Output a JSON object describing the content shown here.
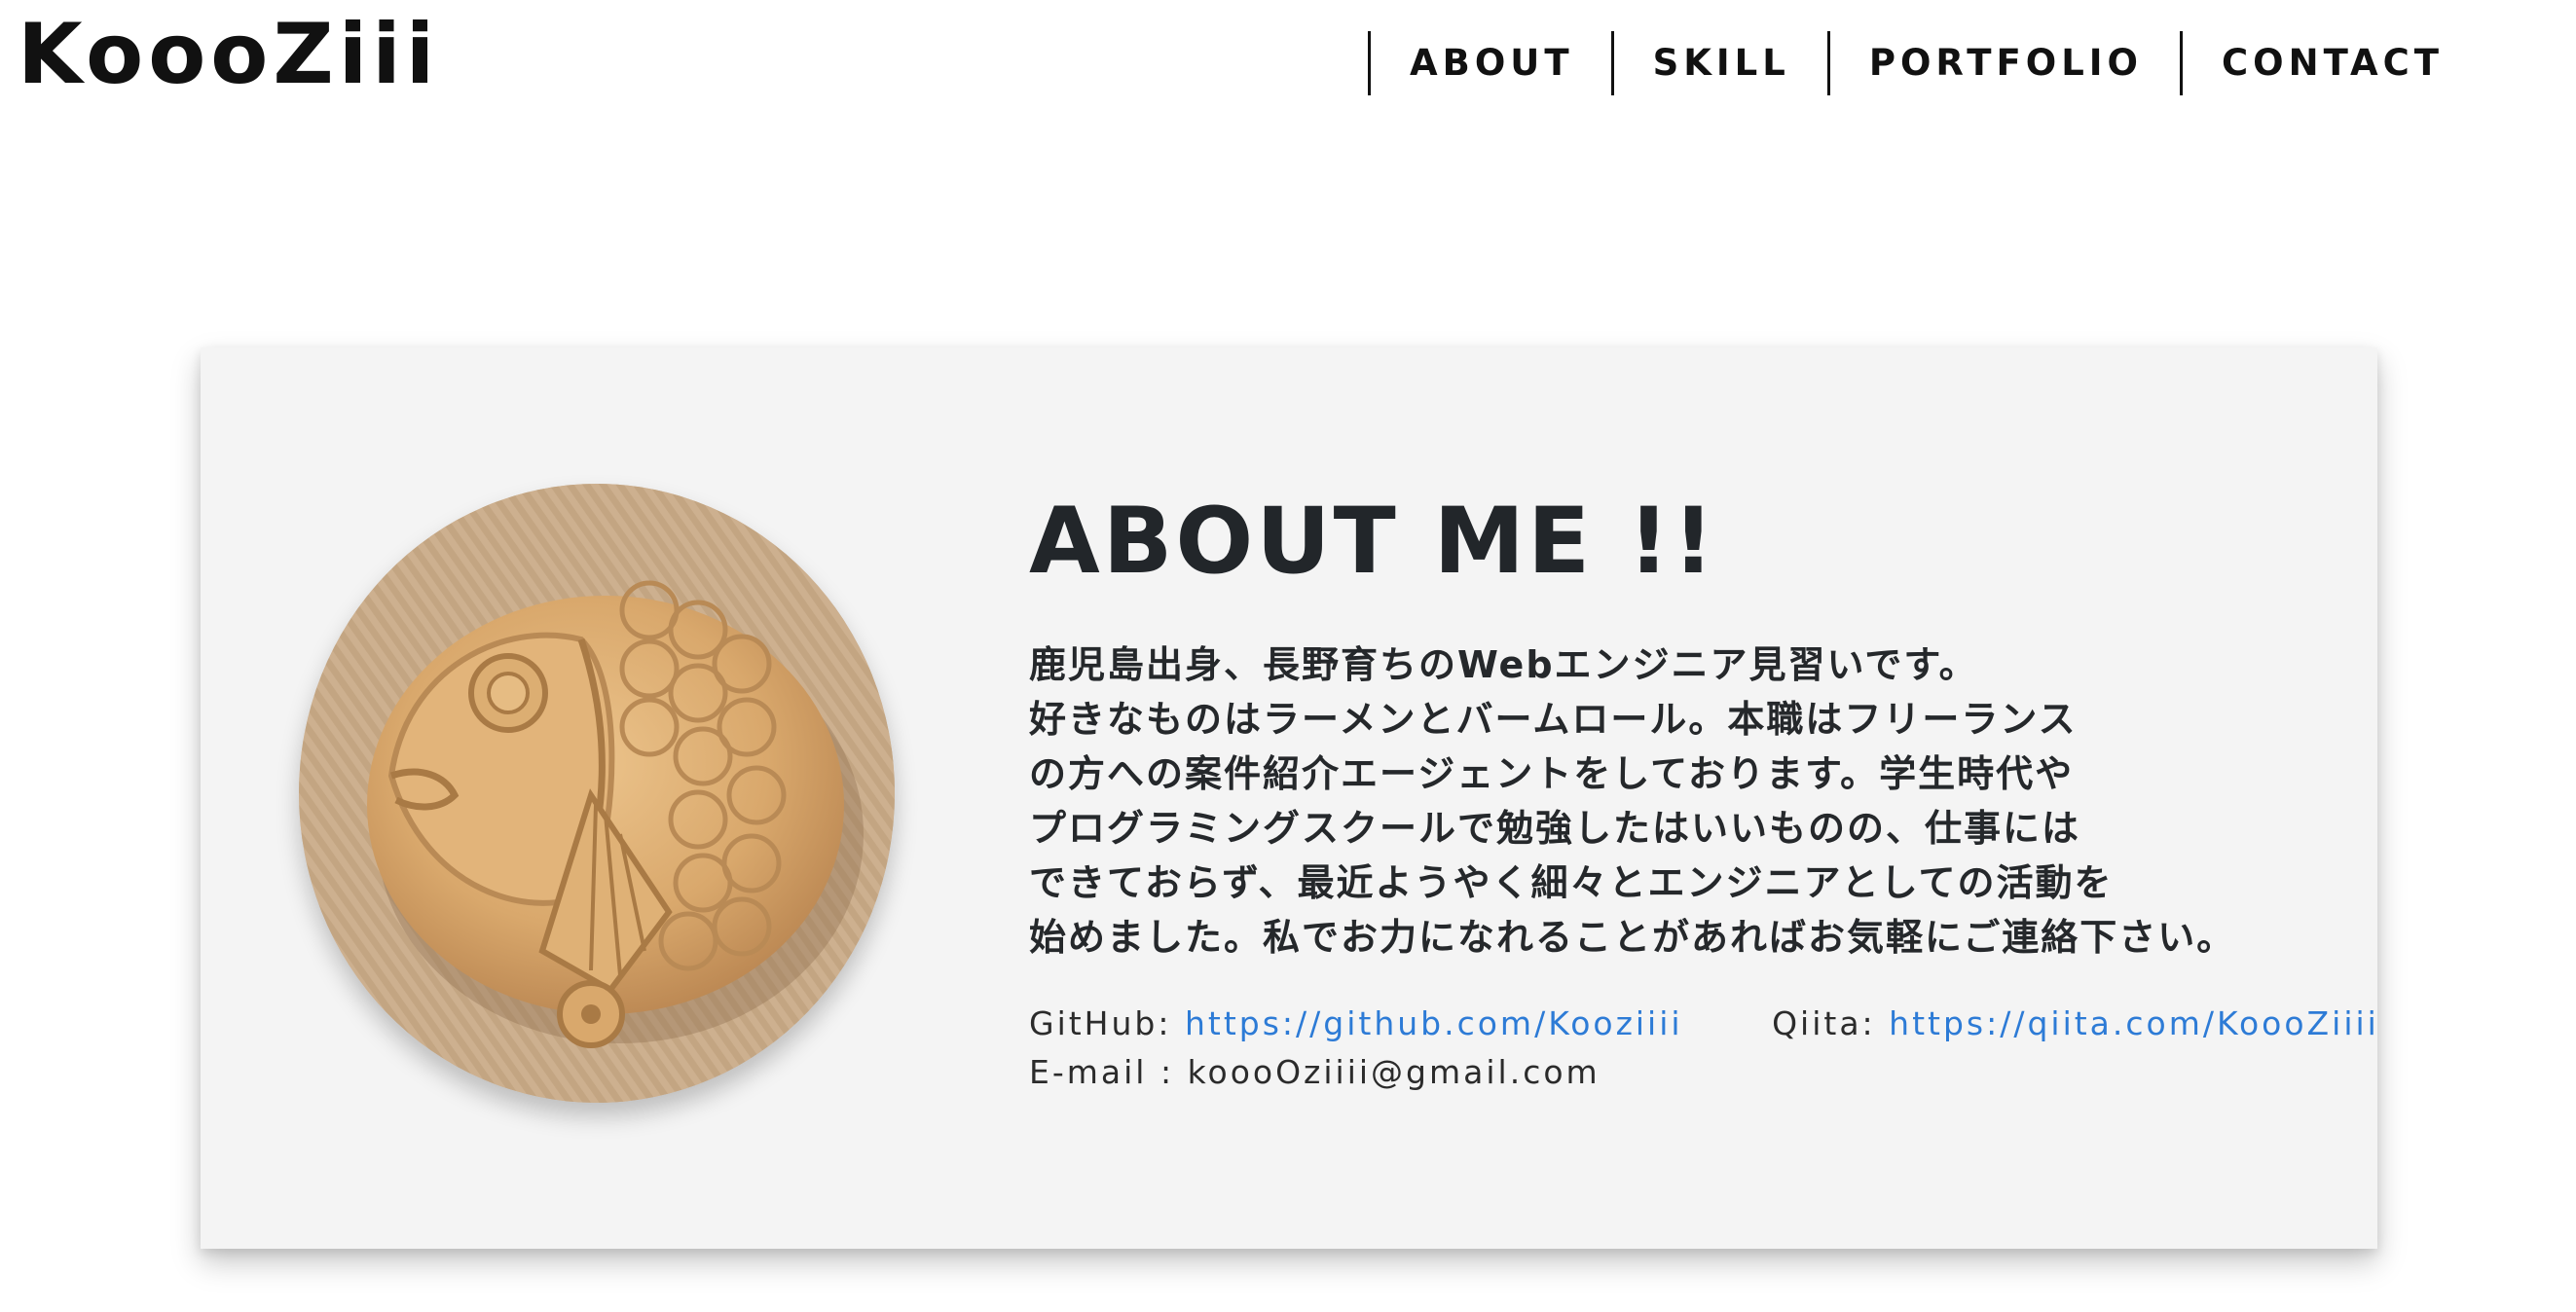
{
  "header": {
    "logo": "KoooZiii",
    "nav": [
      {
        "label": "ABOUT"
      },
      {
        "label": "SKILL"
      },
      {
        "label": "PORTFOLIO"
      },
      {
        "label": "CONTACT"
      }
    ]
  },
  "about": {
    "title": "ABOUT ME !!",
    "bio_lines": [
      "鹿児島出身、長野育ちのWebエンジニア見習いです。",
      "好きなものはラーメンとバームロール。本職はフリーランス",
      "の方への案件紹介エージェントをしております。学生時代や",
      "プログラミングスクールで勉強したはいいものの、仕事には",
      "できておらず、最近ようやく細々とエンジニアとしての活動を",
      "始めました。私でお力になれることがあればお気軽にご連絡下さい。"
    ],
    "github_label": "GitHub:",
    "github_url": "https://github.com/Kooziiii",
    "qiita_label": "Qiita:",
    "qiita_url": "https://qiita.com/KoooZiiii",
    "email_label": "E-mail :",
    "email": "koooOziiii@gmail.com"
  },
  "colors": {
    "link": "#2d7bd6",
    "card_bg": "#f4f4f4",
    "text": "#22262a"
  },
  "icons": {
    "avatar": "taiyaki-photo"
  }
}
